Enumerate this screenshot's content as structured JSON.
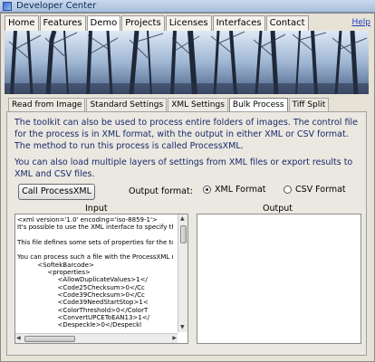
{
  "window": {
    "title": "Developer Center"
  },
  "main_tabs": [
    "Home",
    "Features",
    "Demo",
    "Projects",
    "Licenses",
    "Interfaces",
    "Contact"
  ],
  "help_label": "Help",
  "sub_tabs": [
    "Read from Image",
    "Standard Settings",
    "XML Settings",
    "Bulk Process",
    "Tiff Split"
  ],
  "description": {
    "para1": "The toolkit can also be used to process entire folders of images. The control file for the process is in XML format, with the output in either XML or CSV format. The method to run this process is called ProcessXML.",
    "para2": "You can also load  multiple layers of settings from XML files or export results to XML and CSV files."
  },
  "call_button_label": "Call ProcessXML",
  "output_format": {
    "label": "Output format:",
    "options": [
      "XML Format",
      "CSV Format"
    ],
    "selected": "XML Format"
  },
  "input_label": "Input",
  "output_label": "Output",
  "input_text": "<xml version='1.0' encoding='iso-8859-1'>\nIt's possible to use the XML interface to specify the files th\n\nThis file defines some sets of properties for the toolkit to ap\n\nYou can process such a file with the ProcessXML method\n          <SoftekBarcode>\n               <properties>\n                    <AllowDuplicateValues>1</\n                    <Code25Checksum>0</Cc\n                    <Code39Checksum>0</Cc\n                    <Code39NeedStartStop>1<\n                    <ColorThreshold>0</ColorT\n                    <ConvertUPCEToEAN13>1</\n                    <Despeckle>0</Despeckl",
  "output_text": ""
}
